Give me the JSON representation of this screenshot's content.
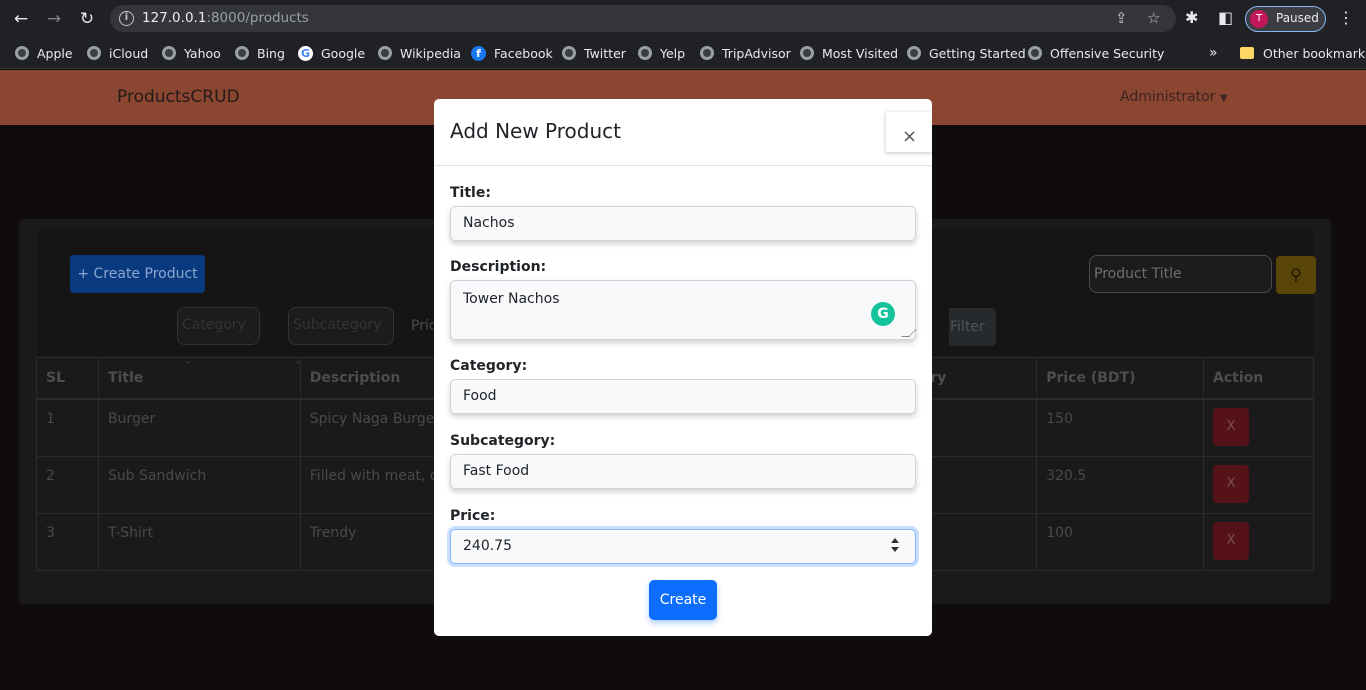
{
  "browser": {
    "url_host": "127.0.0.1",
    "url_rest": ":8000/products",
    "profile_initial": "T",
    "profile_status": "Paused",
    "bookmarks": [
      "Apple",
      "iCloud",
      "Yahoo",
      "Bing",
      "Google",
      "Wikipedia",
      "Facebook",
      "Twitter",
      "Yelp",
      "TripAdvisor",
      "Most Visited",
      "Getting Started",
      "Offensive Security"
    ],
    "overflow": "»",
    "other_bookmarks": "Other bookmarks"
  },
  "navbar": {
    "brand": "ProductsCRUD",
    "user_menu": "Administrator"
  },
  "toolbar": {
    "create_button": "+ Create Product",
    "search_placeholder": "Product Title",
    "category_select": "Category",
    "subcategory_select": "Subcategory",
    "price_label": "Price R",
    "filter_button": "Filter"
  },
  "table": {
    "headers": [
      "SL",
      "Title",
      "Description",
      "ry",
      "Price (BDT)",
      "Action"
    ],
    "rows": [
      {
        "sl": "1",
        "title": "Burger",
        "description": "Spicy Naga Burger",
        "price": "150",
        "action": "X"
      },
      {
        "sl": "2",
        "title": "Sub Sandwich",
        "description": "Filled with meat, ch",
        "price": "320.5",
        "action": "X"
      },
      {
        "sl": "3",
        "title": "T-Shirt",
        "description": "Trendy",
        "price": "100",
        "action": "X"
      }
    ]
  },
  "modal": {
    "title": "Add New Product",
    "close": "×",
    "fields": {
      "title_label": "Title:",
      "title_value": "Nachos",
      "description_label": "Description:",
      "description_value": "Tower Nachos",
      "category_label": "Category:",
      "category_value": "Food",
      "subcategory_label": "Subcategory:",
      "subcategory_value": "Fast Food",
      "price_label": "Price:",
      "price_value": "240.75"
    },
    "submit": "Create",
    "grammarly_glyph": "G"
  }
}
